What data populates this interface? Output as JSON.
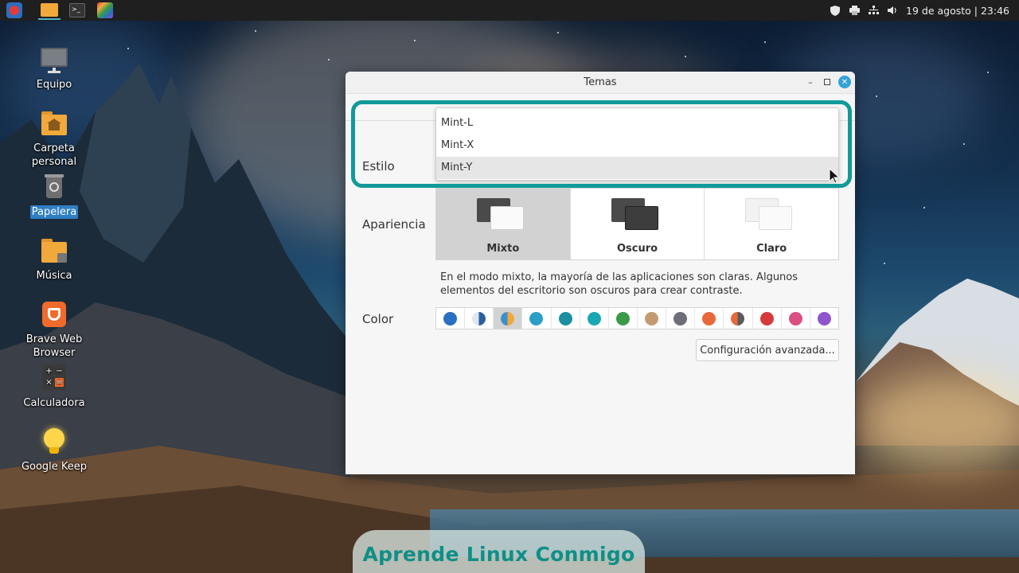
{
  "panel": {
    "launchers": [
      {
        "name": "menu-launcher",
        "icon": "mint-menu-icon",
        "color": "#e33b3b"
      },
      {
        "name": "files-launcher",
        "icon": "folder-icon",
        "color": "#f2a93b"
      },
      {
        "name": "terminal-launcher",
        "icon": "terminal-icon",
        "color": "#333333"
      },
      {
        "name": "paint-launcher",
        "icon": "paint-icon",
        "color": "#9c4bd6"
      }
    ],
    "tray": [
      "shield-icon",
      "printer-icon",
      "network-icon",
      "volume-icon"
    ],
    "clock": "19 de agosto | 23:46"
  },
  "desktop": {
    "icons": [
      {
        "label": "Equipo",
        "icon": "computer-icon"
      },
      {
        "label": "Carpeta personal",
        "icon": "home-folder-icon"
      },
      {
        "label": "Papelera",
        "icon": "trash-icon",
        "selected": true
      },
      {
        "label": "Música",
        "icon": "music-folder-icon"
      },
      {
        "label": "Brave Web Browser",
        "icon": "brave-icon"
      },
      {
        "label": "Calculadora",
        "icon": "calculator-icon"
      },
      {
        "label": "Google Keep",
        "icon": "keep-icon"
      }
    ]
  },
  "window": {
    "title": "Temas",
    "style_label": "Estilo",
    "style_options": [
      "Mint-L",
      "Mint-X",
      "Mint-Y"
    ],
    "style_hovered": "Mint-Y",
    "appearance_label": "Apariencia",
    "appearance_options": [
      {
        "label": "Mixto",
        "selected": true
      },
      {
        "label": "Oscuro",
        "selected": false
      },
      {
        "label": "Claro",
        "selected": false
      }
    ],
    "description": "En el modo mixto, la mayoría de las aplicaciones son claras. Algunos elementos del escritorio son oscuros para crear contraste.",
    "color_label": "Color",
    "colors": [
      "#2a6fc1",
      "half-blue",
      "half-orange",
      "#2c9fc7",
      "#1e8fa0",
      "#1aa7b3",
      "#3a9a4a",
      "#c49a72",
      "#6e6e78",
      "#e8683a",
      "half-orange-dark",
      "#d63a3a",
      "#dc4f82",
      "#8f55cc"
    ],
    "selected_color_index": 2,
    "advanced_button": "Configuración avanzada..."
  },
  "watermark": "Aprende Linux Conmigo",
  "accent_color": "#119a9a"
}
